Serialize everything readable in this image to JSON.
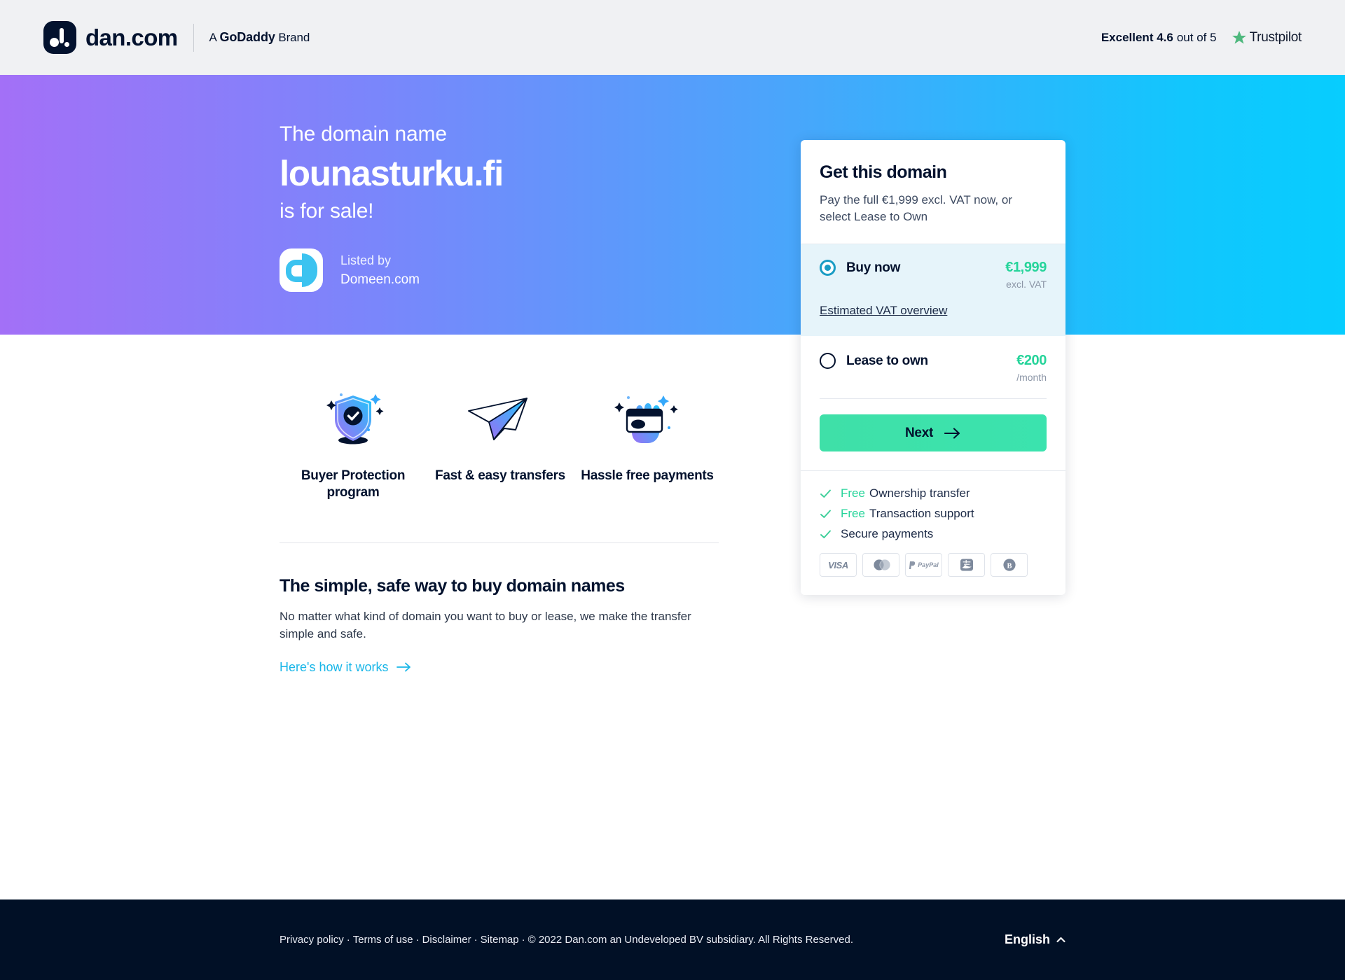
{
  "header": {
    "brand_name": "dan.com",
    "brand_sub_prefix": "A ",
    "brand_sub_bold": "GoDaddy",
    "brand_sub_suffix": " Brand",
    "trust_excellent": "Excellent 4.6",
    "trust_rest": "out of 5",
    "trust_name": "Trustpilot"
  },
  "hero": {
    "pre": "The domain name",
    "domain": "lounasturku.fi",
    "post": "is for sale!",
    "listed_by": "Listed by",
    "listed_name": "Domeen.com"
  },
  "card": {
    "title": "Get this domain",
    "subtitle": "Pay the full €1,999 excl. VAT now, or select Lease to Own",
    "buy_label": "Buy now",
    "buy_price": "€1,999",
    "buy_note": "excl. VAT",
    "vat_link": "Estimated VAT overview",
    "lease_label": "Lease to own",
    "lease_price": "€200",
    "lease_note": "/month",
    "next_label": "Next",
    "benefits": [
      {
        "free": "Free",
        "text": "Ownership transfer"
      },
      {
        "free": "Free",
        "text": "Transaction support"
      },
      {
        "free": "",
        "text": "Secure payments"
      }
    ],
    "payments": [
      "VISA",
      "Mastercard",
      "PayPal",
      "Alipay",
      "Bitcoin"
    ]
  },
  "features": [
    {
      "label": "Buyer Protection program",
      "icon": "shield-check-icon"
    },
    {
      "label": "Fast & easy transfers",
      "icon": "paper-plane-icon"
    },
    {
      "label": "Hassle free payments",
      "icon": "hand-card-icon"
    }
  ],
  "section": {
    "title": "The simple, safe way to buy domain names",
    "body": "No matter what kind of domain you want to buy or lease, we make the transfer simple and safe.",
    "link": "Here's how it works"
  },
  "footer": {
    "links": [
      "Privacy policy",
      "Terms of use",
      "Disclaimer",
      "Sitemap"
    ],
    "copyright": "© 2022 Dan.com an Undeveloped BV subsidiary. All Rights Reserved.",
    "language": "English"
  },
  "colors": {
    "accent_green": "#26d49a",
    "accent_cyan": "#18b6e8",
    "radio_teal": "#1a9cc4",
    "navy": "#03122e",
    "footer_bg": "#011026"
  }
}
